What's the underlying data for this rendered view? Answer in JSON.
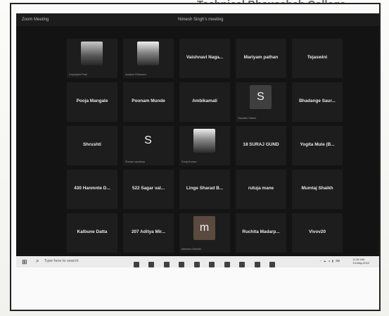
{
  "background_caption": "Technical Bhausaheb College",
  "window": {
    "app_title": "Zoom Meeting",
    "center_title": "Nimesh Singh's meeting"
  },
  "participants": [
    {
      "name": "",
      "sublabel": "Dnyanjeet Patil",
      "avatar": "photo"
    },
    {
      "name": "",
      "sublabel": "Aarjeen Rishwani",
      "avatar": "photo2"
    },
    {
      "name": "Vaishnavi Naga...",
      "sublabel": "",
      "avatar": ""
    },
    {
      "name": "Mariyam pathan",
      "sublabel": "",
      "avatar": ""
    },
    {
      "name": "Tejaswini",
      "sublabel": "",
      "avatar": ""
    },
    {
      "name": "Pooja Mangale",
      "sublabel": "",
      "avatar": ""
    },
    {
      "name": "Poonam Munde",
      "sublabel": "",
      "avatar": ""
    },
    {
      "name": "Ambikamali",
      "sublabel": "",
      "avatar": ""
    },
    {
      "name": "",
      "sublabel": "Saurabh Sabne",
      "avatar": "S"
    },
    {
      "name": "Bhadange Saur...",
      "sublabel": "",
      "avatar": ""
    },
    {
      "name": "Shrushti",
      "sublabel": "",
      "avatar": ""
    },
    {
      "name": "",
      "sublabel": "Sharan sandeep",
      "avatar": "S"
    },
    {
      "name": "",
      "sublabel": "Suraj Kumar",
      "avatar": "photo"
    },
    {
      "name": "18 SURAJ GUND",
      "sublabel": "",
      "avatar": ""
    },
    {
      "name": "Yogita Mule (B...",
      "sublabel": "",
      "avatar": ""
    },
    {
      "name": "430 Hanmnte D...",
      "sublabel": "",
      "avatar": ""
    },
    {
      "name": "522  Sagar val...",
      "sublabel": "",
      "avatar": ""
    },
    {
      "name": "Linge Sharad  B...",
      "sublabel": "",
      "avatar": ""
    },
    {
      "name": "rutuja mane",
      "sublabel": "",
      "avatar": ""
    },
    {
      "name": "Mumtaj Shaikh",
      "sublabel": "",
      "avatar": ""
    },
    {
      "name": "Kalbune Datta",
      "sublabel": "",
      "avatar": ""
    },
    {
      "name": "207 Aditya Mir...",
      "sublabel": "",
      "avatar": ""
    },
    {
      "name": "",
      "sublabel": "Manisha Maruthi",
      "avatar": "m"
    },
    {
      "name": "Ruchita  Madarp...",
      "sublabel": "",
      "avatar": ""
    },
    {
      "name": "Vivov20",
      "sublabel": "",
      "avatar": ""
    }
  ],
  "taskbar": {
    "search_placeholder": "Type here to search",
    "time": "11:51 AM",
    "date": "13-May-2022"
  },
  "icons": {
    "start": "windows-icon",
    "search": "search-icon"
  }
}
